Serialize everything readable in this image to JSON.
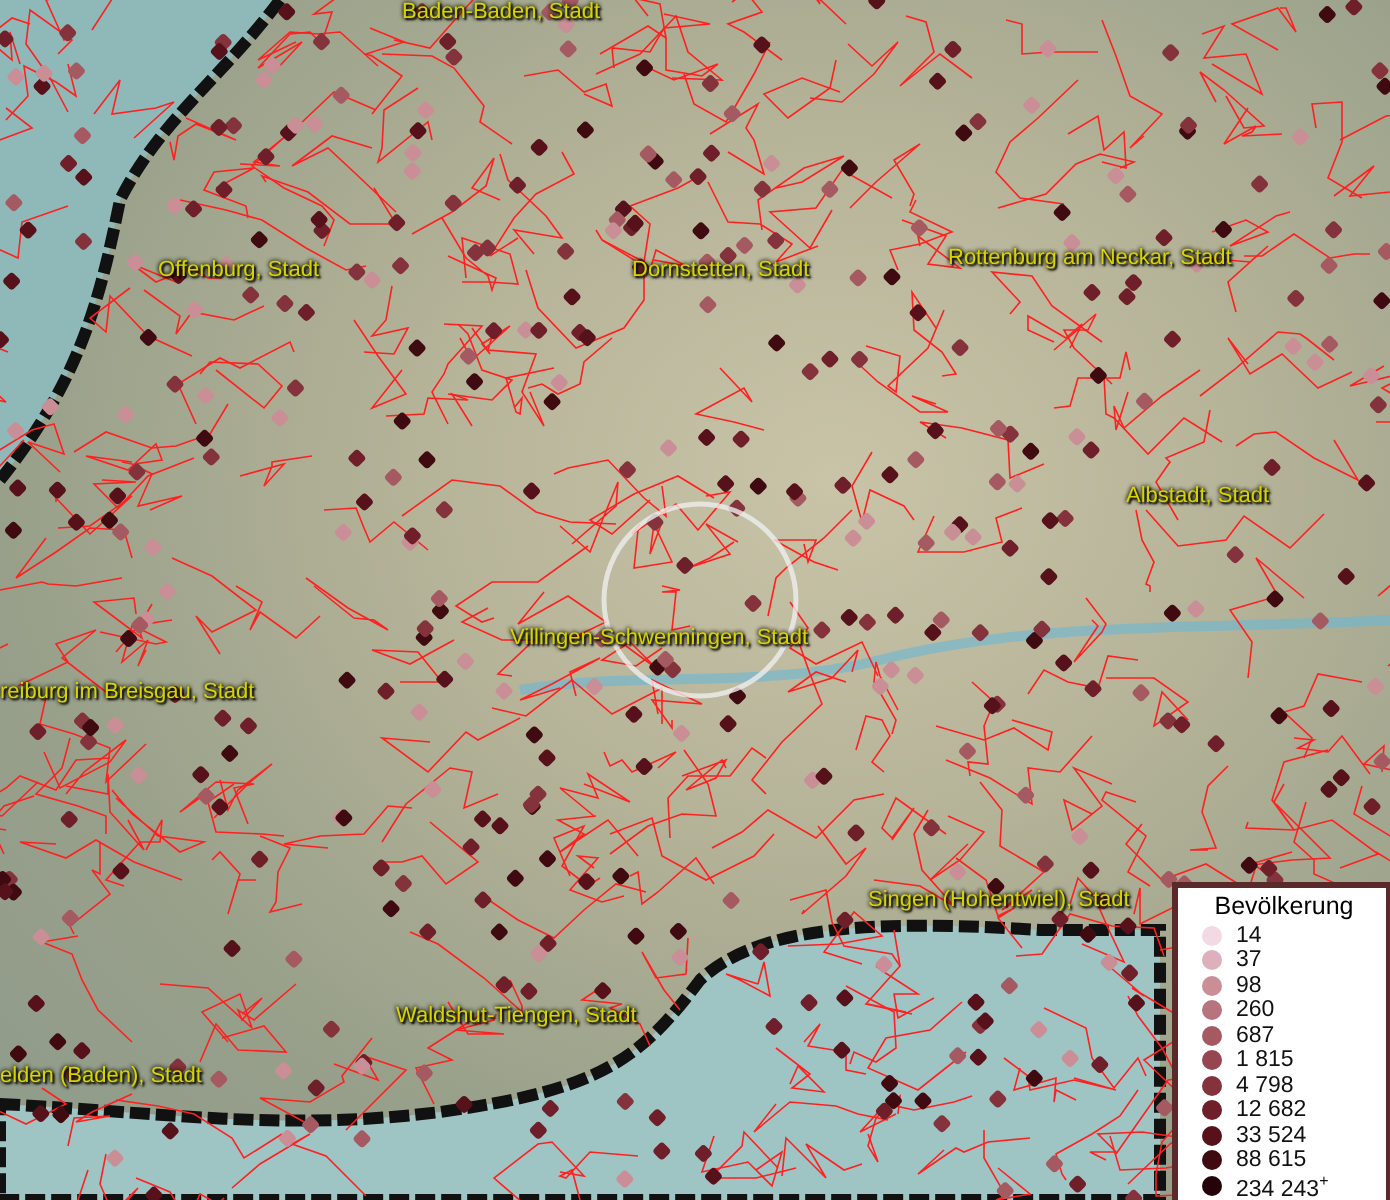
{
  "map_labels": [
    {
      "text": "Baden-Baden, Stadt"
    },
    {
      "text": "Offenburg, Stadt"
    },
    {
      "text": "Dornstetten, Stadt"
    },
    {
      "text": "Rottenburg am Neckar, Stadt"
    },
    {
      "text": "Albstadt, Stadt"
    },
    {
      "text": "Villingen-Schwenningen, Stadt"
    },
    {
      "text": "reiburg im Breisgau, Stadt"
    },
    {
      "text": "Singen (Hohentwiel), Stadt"
    },
    {
      "text": "Waldshut-Tiengen, Stadt"
    },
    {
      "text": "elden (Baden), Stadt"
    }
  ],
  "legend": {
    "title": "Bevölkerung",
    "classes": [
      {
        "label": "14",
        "color": "#f3d9e3"
      },
      {
        "label": "37",
        "color": "#ddb0bb"
      },
      {
        "label": "98",
        "color": "#c98e96"
      },
      {
        "label": "260",
        "color": "#b8747c"
      },
      {
        "label": "687",
        "color": "#a55a62"
      },
      {
        "label": "1 815",
        "color": "#954650"
      },
      {
        "label": "4 798",
        "color": "#84333d"
      },
      {
        "label": "12 682",
        "color": "#6e1f29"
      },
      {
        "label": "33 524",
        "color": "#57111a"
      },
      {
        "label": "88 615",
        "color": "#3f0a10"
      },
      {
        "label": "234 243$^{+}$",
        "color": "#240408"
      }
    ]
  }
}
